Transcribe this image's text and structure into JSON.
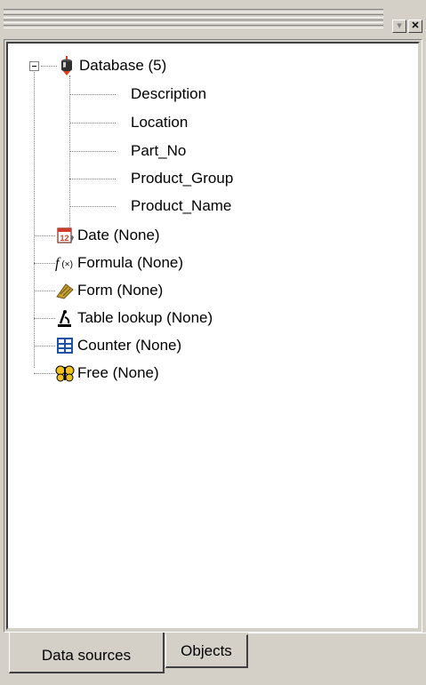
{
  "window": {
    "dropdown_glyph": "▾",
    "close_glyph": "✕"
  },
  "tree": {
    "root": {
      "label": "Database (5)",
      "icon": "database-icon",
      "children": [
        "Description",
        "Location",
        "Part_No",
        "Product_Group",
        "Product_Name"
      ]
    },
    "items": [
      {
        "label": "Date (None)",
        "icon": "calendar-icon"
      },
      {
        "label": "Formula (None)",
        "icon": "formula-icon"
      },
      {
        "label": "Form (None)",
        "icon": "form-icon"
      },
      {
        "label": "Table lookup (None)",
        "icon": "table-lookup-icon"
      },
      {
        "label": "Counter (None)",
        "icon": "counter-icon"
      },
      {
        "label": "Free (None)",
        "icon": "free-icon"
      }
    ]
  },
  "tabs": {
    "data_sources": "Data sources",
    "objects": "Objects"
  },
  "colors": {
    "face": "#d4d0c8",
    "dark_shadow": "#404040",
    "shadow": "#808080",
    "highlight": "#ffffff",
    "database_red": "#e03a1e",
    "calendar_red": "#d23a2a",
    "form_gold": "#c8a030",
    "counter_blue": "#2050a0",
    "free_yellow": "#f0c020"
  }
}
